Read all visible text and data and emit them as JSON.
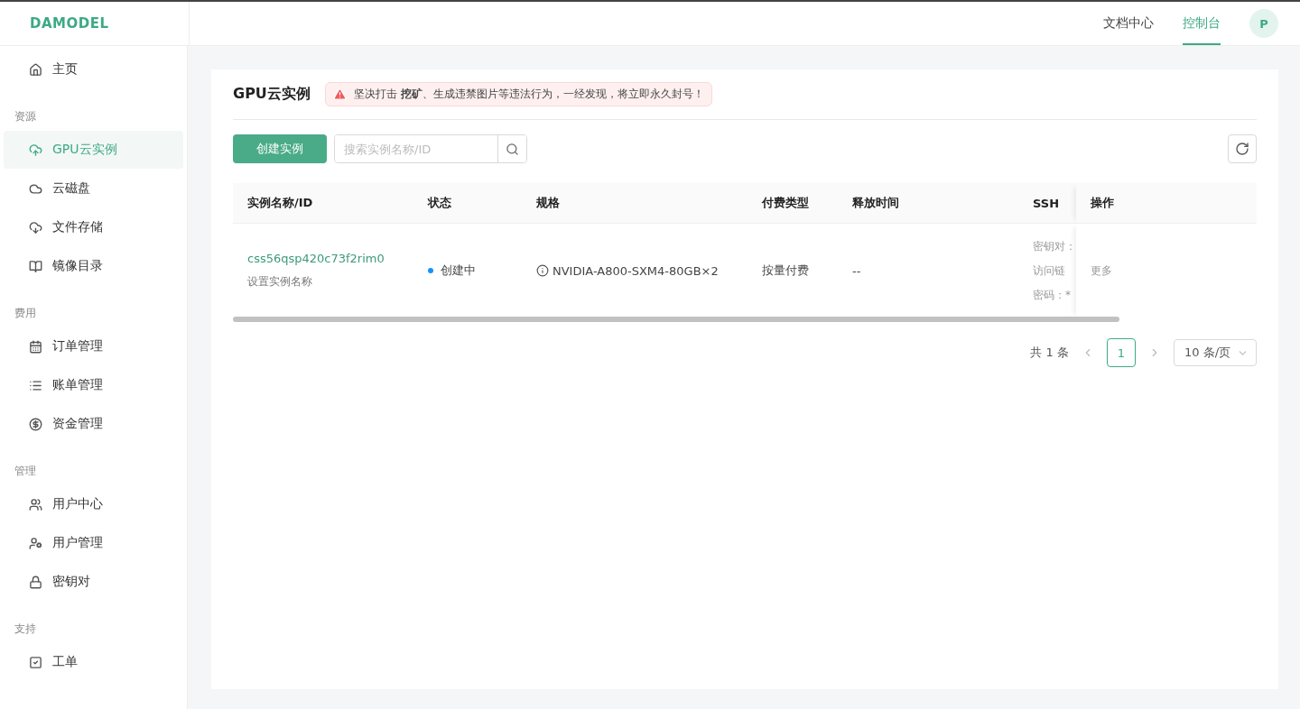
{
  "header": {
    "logo": "DAMODEL",
    "nav": [
      {
        "label": "文档中心",
        "selected": false
      },
      {
        "label": "控制台",
        "selected": true
      }
    ],
    "avatar": "P"
  },
  "sidebar": {
    "sections": [
      {
        "items": [
          {
            "label": "主页",
            "selected": false
          }
        ]
      },
      {
        "title": "资源",
        "items": [
          {
            "label": "GPU云实例",
            "selected": true
          },
          {
            "label": "云磁盘",
            "selected": false
          },
          {
            "label": "文件存储",
            "selected": false
          },
          {
            "label": "镜像目录",
            "selected": false
          }
        ]
      },
      {
        "title": "费用",
        "items": [
          {
            "label": "订单管理",
            "selected": false
          },
          {
            "label": "账单管理",
            "selected": false
          },
          {
            "label": "资金管理",
            "selected": false
          }
        ]
      },
      {
        "title": "管理",
        "items": [
          {
            "label": "用户中心",
            "selected": false
          },
          {
            "label": "用户管理",
            "selected": false
          },
          {
            "label": "密钥对",
            "selected": false
          }
        ]
      },
      {
        "title": "支持",
        "items": [
          {
            "label": "工单",
            "selected": false
          }
        ]
      }
    ]
  },
  "page": {
    "title": "GPU云实例",
    "alert": "坚决打击 **挖矿**、生成违禁图片等违法行为，一经发现，将立即永久封号！",
    "create_button": "创建实例",
    "search": {
      "placeholder": "搜索实例名称/ID"
    }
  },
  "table": {
    "columns": [
      "实例名称/ID",
      "状态",
      "规格",
      "付费类型",
      "释放时间",
      "SSH",
      "操作"
    ],
    "rows": [
      {
        "id": "css56qsp420c73f2rim0",
        "name_hint": "设置实例名称",
        "status": "创建中",
        "color": "#1890ff",
        "spec": "NVIDIA-A800-SXM4-80GB×2",
        "billing": "按量付费",
        "release": "--",
        "ssh": [
          "密钥对：",
          "访问链",
          "密码：*"
        ],
        "action": "更多"
      }
    ]
  },
  "pagination": {
    "total": "共 1 条",
    "pages": [
      {
        "label": "1",
        "selected": true
      }
    ],
    "page_size": "10 条/页"
  }
}
